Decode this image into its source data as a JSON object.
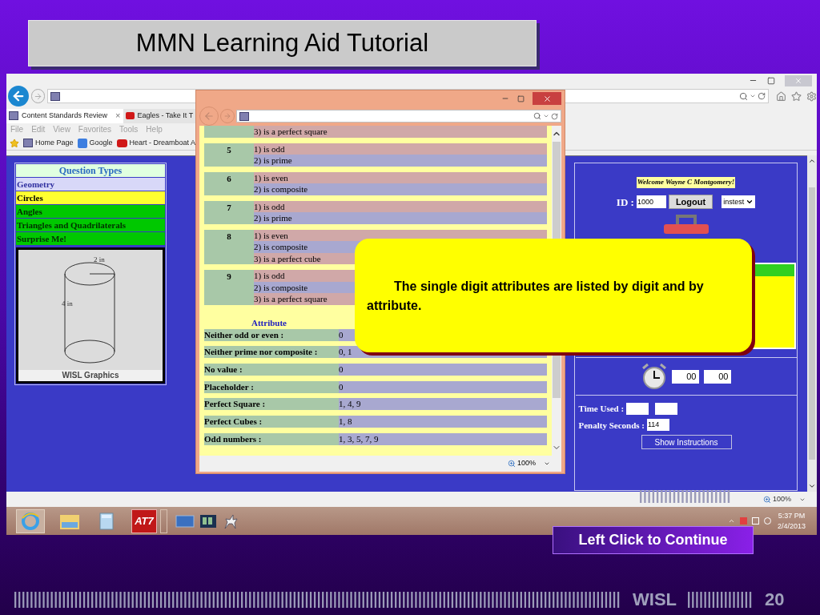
{
  "slide": {
    "title": "MMN Learning Aid Tutorial",
    "continue_button": "Left Click to Continue",
    "footer_brand": "WISL",
    "page_number": "20"
  },
  "browser": {
    "tabs": [
      {
        "label": "Content Standards Review",
        "close": "×",
        "selected": true
      },
      {
        "label": "Eagles - Take It T",
        "selected": false
      }
    ],
    "menu": [
      "File",
      "Edit",
      "View",
      "Favorites",
      "Tools",
      "Help"
    ],
    "favorites": [
      {
        "label": "Home Page",
        "kind": "site"
      },
      {
        "label": "Google",
        "kind": "google"
      },
      {
        "label": "Heart - Dreamboat A",
        "kind": "video"
      }
    ],
    "zoom": "100%"
  },
  "question_types": {
    "title": "Question Types",
    "items": [
      {
        "label": "Geometry",
        "kind": "category",
        "selected": false
      },
      {
        "label": "Circles",
        "kind": "option",
        "selected": true
      },
      {
        "label": "Angles",
        "kind": "option",
        "selected": false
      },
      {
        "label": "Triangles and Quadrilaterals",
        "kind": "option",
        "selected": false
      },
      {
        "label": "Surprise Me!",
        "kind": "option",
        "selected": false
      }
    ]
  },
  "figure": {
    "radius_label": "2 in",
    "height_label": "4 in",
    "caption": "WISL Graphics"
  },
  "session": {
    "welcome": "Welcome Wayne C Montgomery!",
    "id_label": "ID :",
    "id_value": "1000",
    "logout": "Logout",
    "account": "instest",
    "timer": [
      "00",
      "00"
    ],
    "time_used_label": "Time Used :",
    "penalty_label": "Penalty Seconds :",
    "penalty_value": "114",
    "instructions_button": "Show Instructions"
  },
  "popup": {
    "digits": [
      {
        "attributes": [
          "3) is a perfect square"
        ]
      },
      {
        "digit": "5",
        "attributes": [
          "1) is odd",
          "2) is prime"
        ]
      },
      {
        "digit": "6",
        "attributes": [
          "1) is even",
          "2) is composite"
        ]
      },
      {
        "digit": "7",
        "attributes": [
          "1) is odd",
          "2) is prime"
        ]
      },
      {
        "digit": "8",
        "attributes": [
          "1) is even",
          "2) is composite",
          "3) is a perfect cube"
        ]
      },
      {
        "digit": "9",
        "attributes": [
          "1) is odd",
          "2) is composite",
          "3) is a perfect square"
        ]
      }
    ],
    "attribute_heading": "Attribute",
    "attribute_rows": [
      {
        "label": "Neither odd or even :",
        "value": "0"
      },
      {
        "label": "Neither prime nor composite :",
        "value": "0, 1"
      },
      {
        "label": "No value :",
        "value": "0"
      },
      {
        "label": "Placeholder :",
        "value": "0"
      },
      {
        "label": "Perfect Square :",
        "value": "1, 4, 9"
      },
      {
        "label": "Perfect Cubes :",
        "value": "1, 8"
      },
      {
        "label": "Odd numbers :",
        "value": "1, 3, 5, 7, 9"
      }
    ],
    "zoom": "100%"
  },
  "callout": "The single digit attributes are listed by digit and by attribute.",
  "taskbar": {
    "app_label": "AT7",
    "time": "5:37 PM",
    "date": "2/4/2013"
  }
}
